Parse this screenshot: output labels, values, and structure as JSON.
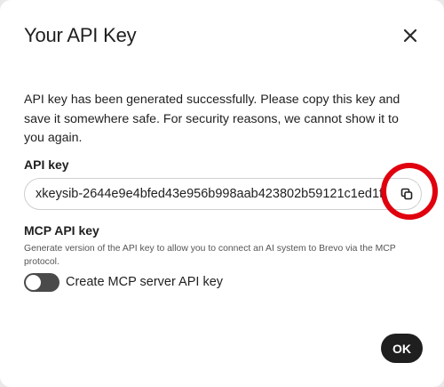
{
  "dialog": {
    "title": "Your API Key",
    "description": "API key has been generated successfully. Please copy this key and save it somewhere safe. For security reasons, we cannot show it to you again.",
    "api_key": {
      "label": "API key",
      "value": "xkeysib-2644e9e4bfed43e956b998aab423802b59121c1ed1f"
    },
    "mcp": {
      "label": "MCP API key",
      "description": "Generate version of the API key to allow you to connect an AI system to Brevo via the MCP protocol.",
      "toggle_label": "Create MCP server API key",
      "toggle_on": false
    },
    "ok_label": "OK"
  },
  "icons": {
    "close": "close-icon",
    "copy": "copy-icon"
  },
  "colors": {
    "annotation": "#e0000e",
    "primary_button": "#1f1f1f",
    "toggle_off": "#4a4a4a"
  }
}
